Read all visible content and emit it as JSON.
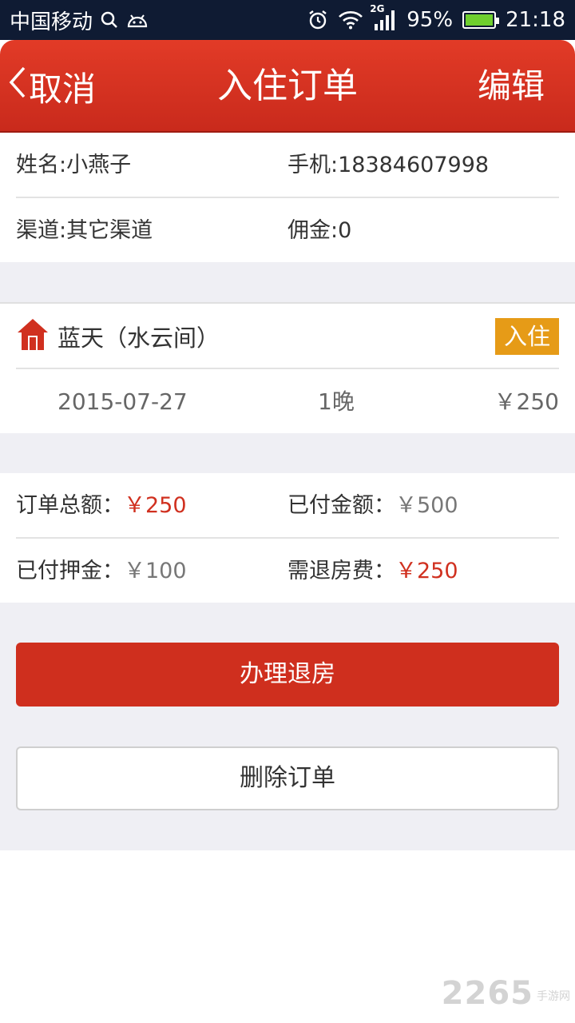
{
  "status_bar": {
    "carrier": "中国移动",
    "network": "2G",
    "battery": "95%",
    "time": "21:18",
    "icons": [
      "search-icon",
      "android-icon",
      "alarm-icon",
      "wifi-icon",
      "signal-icon",
      "battery-icon"
    ]
  },
  "header": {
    "back_label": "取消",
    "title": "入住订单",
    "edit_label": "编辑",
    "background_color": "#d3301f"
  },
  "guest": {
    "name": "姓名:小燕子",
    "phone": "手机:18384607998",
    "channel": "渠道:其它渠道",
    "commission": "佣金:0"
  },
  "room": {
    "name": "蓝天（水云间）",
    "status_badge": "入住",
    "badge_color": "#e69b17",
    "icon": "house-icon",
    "date": "2015-07-27",
    "nights": "1晚",
    "price": "￥250"
  },
  "payment": {
    "total_label": "订单总额：",
    "total_value": "￥250",
    "paid_label": "已付金额：",
    "paid_value": "￥500",
    "deposit_label": "已付押金：",
    "deposit_value": "￥100",
    "refund_label": "需退房费：",
    "refund_value": "￥250",
    "accent_color": "#d0301f"
  },
  "actions": {
    "checkout_label": "办理退房",
    "delete_label": "删除订单"
  },
  "watermark": {
    "brand": "2265",
    "suffix": "手游网"
  }
}
